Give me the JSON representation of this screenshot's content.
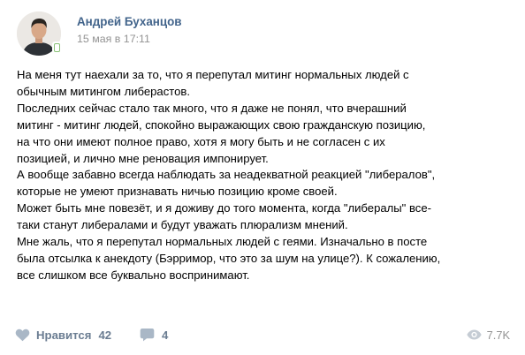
{
  "post": {
    "author": "Андрей Буханцов",
    "date": "15 мая в 17:11",
    "lines": [
      "На меня тут наехали за то, что я перепутал митинг нормальных людей с",
      "обычным митингом либерастов.",
      "Последних сейчас стало так много, что я даже не понял, что вчерашний",
      "митинг - митинг людей, спокойно выражающих свою гражданскую позицию,",
      "на что они имеют полное право, хотя я могу быть и не согласен с их",
      "позицией, и лично мне реновация импонирует.",
      "А вообще забавно всегда наблюдать за неадекватной реакцией \"либералов\",",
      "которые не умеют признавать ничью позицию кроме своей.",
      "Может быть мне повезёт, и я доживу до того момента, когда \"либералы\" все-",
      "таки станут либералами и будут уважать плюрализм мнений.",
      "Мне жаль, что я перепутал нормальных людей с геями. Изначально в посте",
      "была отсылка к анекдоту (Бэрримор, что это за шум на улице?). К сожалению,",
      "все слишком все буквально воспринимают."
    ]
  },
  "footer": {
    "like_label": "Нравится",
    "like_count": "42",
    "comment_count": "4",
    "views_count": "7.7K"
  },
  "icons": {
    "like": "heart-icon",
    "comment": "speech-bubble-icon",
    "views": "eye-icon",
    "online": "mobile-online-icon"
  },
  "colors": {
    "author": "#42648b",
    "date": "#939393",
    "action": "#6b7d92",
    "icon": "#a9b7c6",
    "online": "#8ac176"
  }
}
